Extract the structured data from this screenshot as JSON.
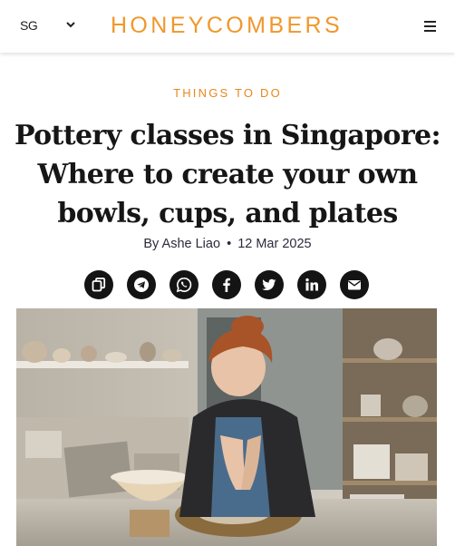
{
  "header": {
    "region": "SG",
    "logo": "HONEYCOMBERS"
  },
  "article": {
    "category": "THINGS TO DO",
    "title": "Pottery classes in Singapore: Where to create your own bowls, cups, and plates",
    "author": "By Ashe Liao",
    "separator": "•",
    "date": "12 Mar 2025"
  },
  "share": {
    "icons": [
      "copy-icon",
      "telegram-icon",
      "whatsapp-icon",
      "facebook-icon",
      "twitter-icon",
      "linkedin-icon",
      "email-icon"
    ]
  },
  "colors": {
    "brand": "#f0972b",
    "category": "#e8871d",
    "share_bg": "#141414"
  }
}
